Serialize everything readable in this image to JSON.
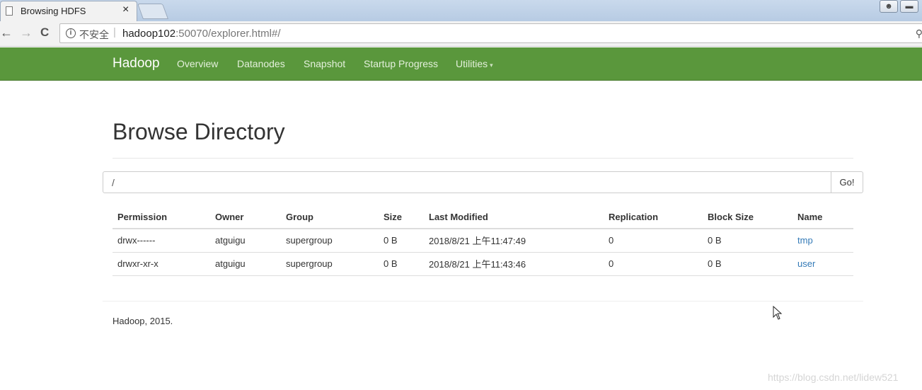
{
  "browser": {
    "tab_title": "Browsing HDFS",
    "tab_close": "×",
    "insecure_label": "不安全",
    "url_host": "hadoop102",
    "url_rest": ":50070/explorer.html#/",
    "back_icon": "←",
    "forward_icon": "→",
    "reload_icon": "C"
  },
  "navbar": {
    "brand": "Hadoop",
    "links": [
      "Overview",
      "Datanodes",
      "Snapshot",
      "Startup Progress",
      "Utilities"
    ],
    "caret": "▾"
  },
  "main": {
    "title": "Browse Directory",
    "path_value": "/",
    "go_label": "Go!"
  },
  "table": {
    "headers": [
      "Permission",
      "Owner",
      "Group",
      "Size",
      "Last Modified",
      "Replication",
      "Block Size",
      "Name"
    ],
    "rows": [
      [
        "drwx------",
        "atguigu",
        "supergroup",
        "0 B",
        "2018/8/21 上午11:47:49",
        "0",
        "0 B",
        "tmp"
      ],
      [
        "drwxr-xr-x",
        "atguigu",
        "supergroup",
        "0 B",
        "2018/8/21 上午11:43:46",
        "0",
        "0 B",
        "user"
      ]
    ]
  },
  "footer": "Hadoop, 2015.",
  "watermark": "https://blog.csdn.net/lidew521",
  "colors": {
    "navbar": "#5a973c",
    "link": "#337ab7"
  }
}
